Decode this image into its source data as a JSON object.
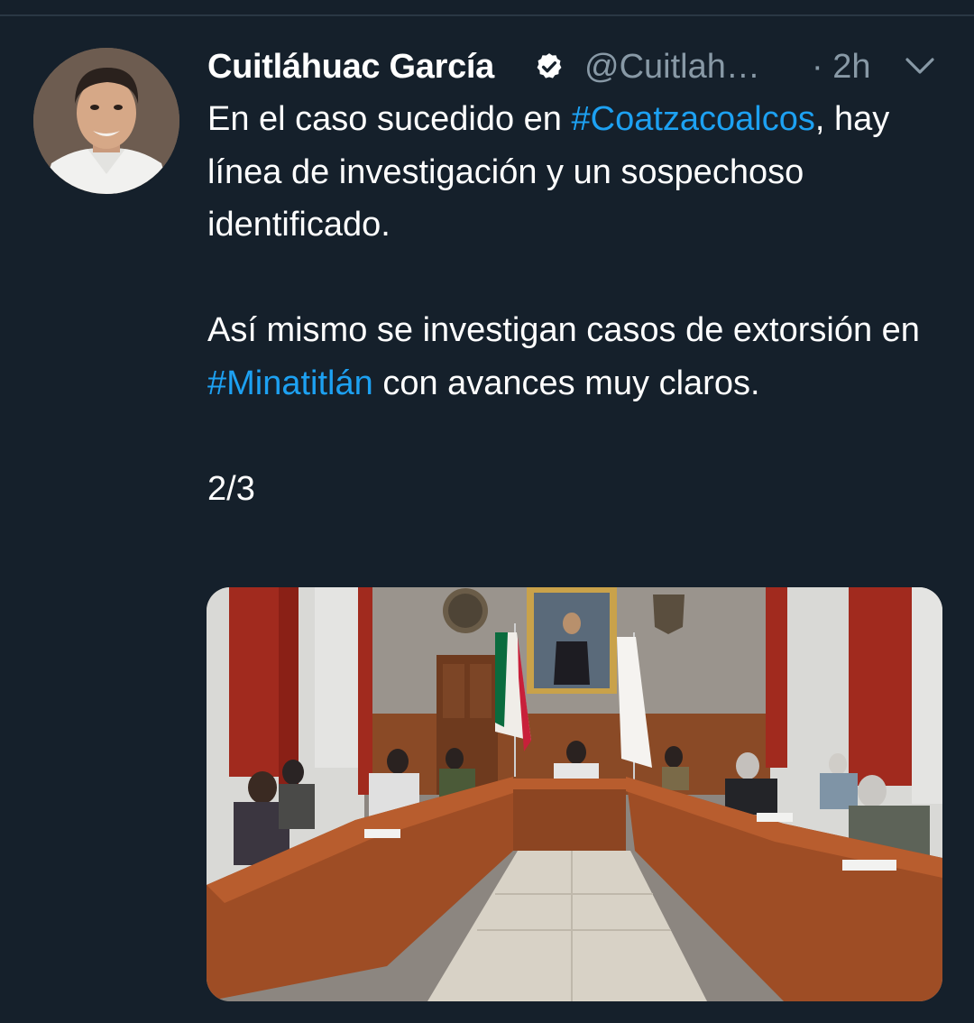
{
  "tweet": {
    "author": {
      "display_name": "Cuitláhuac García",
      "handle": "@Cuitlah…",
      "verified": true,
      "avatar_icon": "profile-photo"
    },
    "time": "· 2h",
    "menu_icon": "chevron-down-icon",
    "text": {
      "p1_before": "En el caso sucedido en ",
      "p1_hashtag": "#Coatzacoalcos",
      "p1_after": ", hay línea de investigación y un sospechoso identificado.",
      "p2_before": "Así mismo se investigan casos de extorsión en ",
      "p2_hashtag": "#Minatitlán",
      "p2_after": " con avances muy claros.",
      "p3": "2/3"
    },
    "media": {
      "type": "photo",
      "description_icon": "meeting-room-photo"
    }
  },
  "colors": {
    "background": "#15202b",
    "text": "#ffffff",
    "secondary": "#8899a6",
    "link": "#1da1f2"
  }
}
